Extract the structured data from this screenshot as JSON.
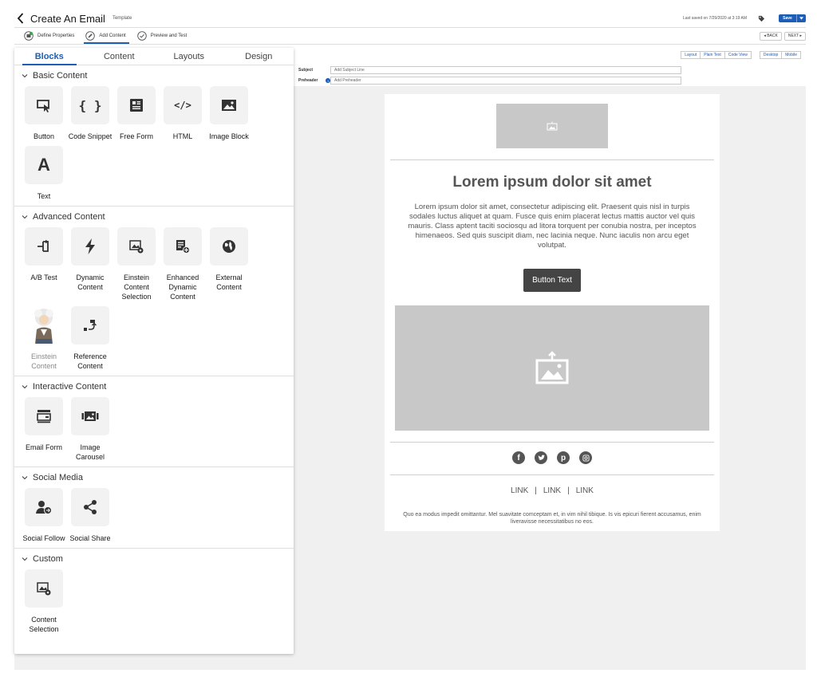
{
  "header": {
    "title": "Create An Email",
    "tag": "Template",
    "last_saved": "Last saved on 7/29/2020 at 3:19 AM",
    "save_label": "Save"
  },
  "steps": [
    {
      "label": "Define Properties"
    },
    {
      "label": "Add Content"
    },
    {
      "label": "Preview and Test"
    }
  ],
  "nav": {
    "back": "◂ BACK",
    "next": "NEXT ▸"
  },
  "view_tabs": [
    "Layout",
    "Plain Text",
    "Code View"
  ],
  "device_tabs": [
    "Desktop",
    "Mobile"
  ],
  "properties": {
    "subject_label": "Subject",
    "subject_placeholder": "Add Subject Line",
    "preheader_label": "Preheader",
    "preheader_placeholder": "Add Preheader"
  },
  "panel": {
    "tabs": [
      "Blocks",
      "Content",
      "Layouts",
      "Design"
    ],
    "sections": [
      {
        "title": "Basic Content",
        "blocks": [
          {
            "label": "Button",
            "icon": "button-icon"
          },
          {
            "label": "Code Snippet",
            "icon": "code-snippet-icon"
          },
          {
            "label": "Free Form",
            "icon": "free-form-icon"
          },
          {
            "label": "HTML",
            "icon": "html-icon"
          },
          {
            "label": "Image Block",
            "icon": "image-icon"
          },
          {
            "label": "Text",
            "icon": "text-icon"
          }
        ]
      },
      {
        "title": "Advanced Content",
        "blocks": [
          {
            "label": "A/B Test",
            "icon": "ab-test-icon"
          },
          {
            "label": "Dynamic Content",
            "icon": "lightning-icon"
          },
          {
            "label": "Einstein Content Selection",
            "icon": "einstein-selection-icon"
          },
          {
            "label": "Enhanced Dynamic Content",
            "icon": "enhanced-dynamic-icon"
          },
          {
            "label": "External Content",
            "icon": "globe-icon"
          },
          {
            "label": "Einstein Content",
            "icon": "einstein-avatar-icon"
          },
          {
            "label": "Reference Content",
            "icon": "reference-icon"
          }
        ]
      },
      {
        "title": "Interactive Content",
        "blocks": [
          {
            "label": "Email Form",
            "icon": "email-form-icon"
          },
          {
            "label": "Image Carousel",
            "icon": "carousel-icon"
          }
        ]
      },
      {
        "title": "Social Media",
        "blocks": [
          {
            "label": "Social Follow",
            "icon": "social-follow-icon"
          },
          {
            "label": "Social Share",
            "icon": "share-icon"
          }
        ]
      },
      {
        "title": "Custom",
        "blocks": [
          {
            "label": "Content Selection",
            "icon": "content-selection-icon"
          }
        ]
      }
    ]
  },
  "email": {
    "headline": "Lorem ipsum dolor sit amet",
    "body": "Lorem ipsum dolor sit amet, consectetur adipiscing elit. Praesent quis nisl in turpis sodales luctus aliquet at quam. Fusce quis enim placerat lectus mattis auctor vel quis mauris. Class aptent taciti sociosqu ad litora torquent per conubia nostra, per inceptos himenaeos. Sed quis suscipit diam, nec lacinia neque. Nunc iaculis non arcu eget volutpat.",
    "button": "Button Text",
    "social_icons": [
      "facebook-icon",
      "twitter-icon",
      "pinterest-icon",
      "instagram-icon"
    ],
    "links": [
      "LINK",
      "|",
      "LINK",
      "|",
      "LINK"
    ],
    "footer": "Quo ea modus impedit omittantur. Mel suavitate comceptam et, in vim nihil tibique. Is vis epicuri fierent accusamus, enim liveravisse necessitatibus no eos."
  },
  "colors": {
    "accent": "#1b5db7",
    "placeholder": "#c8c8c8",
    "button": "#444444"
  }
}
